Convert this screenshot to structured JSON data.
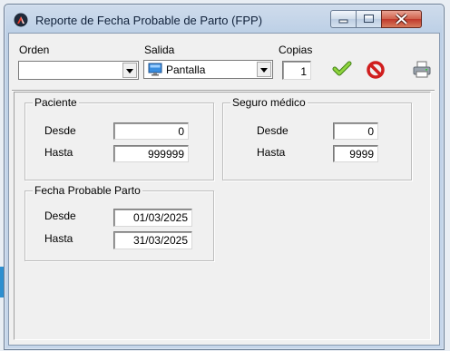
{
  "window": {
    "title": "Reporte de Fecha Probable de Parto (FPP)"
  },
  "toolbar": {
    "orden_label": "Orden",
    "orden_value": "",
    "salida_label": "Salida",
    "salida_value": "Pantalla",
    "copias_label": "Copias",
    "copias_value": "1"
  },
  "paciente": {
    "title": "Paciente",
    "desde_label": "Desde",
    "desde_value": "0",
    "hasta_label": "Hasta",
    "hasta_value": "999999"
  },
  "seguro": {
    "title": "Seguro médico",
    "desde_label": "Desde",
    "desde_value": "0",
    "hasta_label": "Hasta",
    "hasta_value": "9999"
  },
  "fpp": {
    "title": "Fecha Probable Parto",
    "desde_label": "Desde",
    "desde_value": "01/03/2025",
    "hasta_label": "Hasta",
    "hasta_value": "31/03/2025"
  },
  "icons": {
    "app": "app-logo-icon",
    "accept": "checkmark-icon",
    "cancel": "no-entry-icon",
    "print": "printer-icon",
    "screen": "monitor-icon"
  },
  "colors": {
    "accept": "#6cb62a",
    "cancel": "#d01e1e",
    "close_button": "#c0382a"
  }
}
